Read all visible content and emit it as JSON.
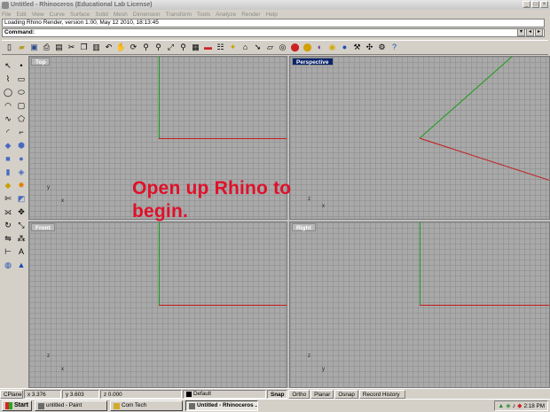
{
  "window": {
    "title": "Untitled - Rhinoceros (Educational Lab License)",
    "buttons": [
      "_",
      "□",
      "×"
    ]
  },
  "menu": [
    "File",
    "Edit",
    "View",
    "Curve",
    "Surface",
    "Solid",
    "Mesh",
    "Dimension",
    "Transform",
    "Tools",
    "Analyze",
    "Render",
    "Help"
  ],
  "command": {
    "history": "Loading Rhino Render, version 1.00, May 12 2010, 18:13:45",
    "prompt": "Command:"
  },
  "toolbar_icons": [
    "new-icon",
    "open-icon",
    "save-icon",
    "print-icon",
    "import-icon",
    "cut-icon",
    "copy-icon",
    "paste-icon",
    "undo-icon",
    "pan-icon",
    "rotate-view-icon",
    "zoom-icon",
    "zoom-window-icon",
    "zoom-extents-icon",
    "zoom-selected-icon",
    "grid-icon",
    "layer-icon",
    "properties-icon",
    "light-icon",
    "tag-icon",
    "arrow-icon",
    "cplane-icon",
    "wireframe-icon",
    "shaded-icon",
    "rendered-icon",
    "render-icon",
    "material-icon",
    "sphere-icon",
    "tools-icon",
    "osnap-icon",
    "options-icon",
    "help-icon"
  ],
  "viewports": {
    "top": "Top",
    "perspective": "Perspective",
    "front": "Front",
    "right": "Right",
    "axis_y": "y",
    "axis_x": "x",
    "axis_z": "z"
  },
  "overlay_text": [
    "Open up Rhino to",
    "begin."
  ],
  "status": {
    "cplane": "CPlane",
    "x": "x 3.376",
    "y": "y 3.603",
    "z": "z 0.000",
    "layer": "Default",
    "snap": "Snap",
    "ortho": "Ortho",
    "planar": "Planar",
    "osnap": "Osnap",
    "record": "Record History"
  },
  "taskbar": {
    "start": "Start",
    "tasks": [
      "untitled - Paint",
      "Com Tech",
      "Untitled - Rhinoceros ..."
    ],
    "clock": "2:18 PM"
  },
  "colors": {
    "accent": "#0a246a",
    "x_axis": "#c41a1a",
    "y_axis": "#1a9c1a",
    "overlay": "#e0102a"
  }
}
